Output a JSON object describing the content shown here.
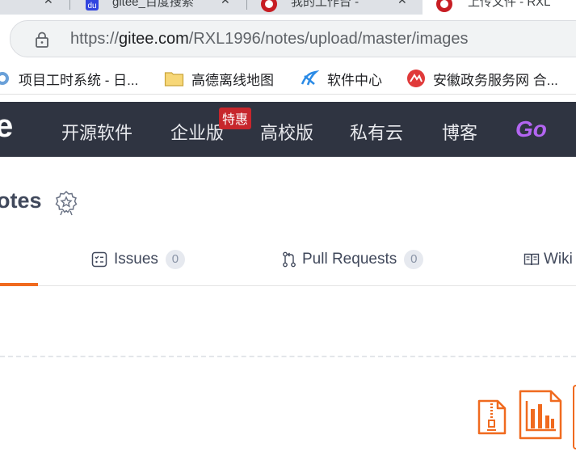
{
  "browser": {
    "tabs": [
      {
        "title": "gitee_百度搜索"
      },
      {
        "title": "我的工作台 -"
      },
      {
        "title": "上传文件 - RXL"
      }
    ],
    "url_prefix": "https://",
    "url_domain": "gitee.com",
    "url_path": "/RXL1996/notes/upload/master/images",
    "bookmarks": [
      {
        "label": "项目工时系统 - 日..."
      },
      {
        "label": "高德离线地图"
      },
      {
        "label": "软件中心"
      },
      {
        "label": "安徽政务服务网 合..."
      }
    ]
  },
  "site": {
    "logo_fragment": "e",
    "nav": [
      {
        "label": "开源软件"
      },
      {
        "label": "企业版"
      },
      {
        "label": "高校版"
      },
      {
        "label": "私有云"
      },
      {
        "label": "博客"
      }
    ],
    "hot_badge": "特惠",
    "go_label": "Go",
    "brand_color": "#f06a1f",
    "nav_bg": "#2f3441"
  },
  "repo": {
    "title_fragment": "otes",
    "tabs": [
      {
        "label": "Issues",
        "count": "0",
        "icon": "issues-icon"
      },
      {
        "label": "Pull Requests",
        "count": "0",
        "icon": "pull-request-icon"
      },
      {
        "label": "Wiki",
        "icon": "wiki-icon"
      }
    ]
  },
  "file_icons": [
    "zip-file-icon",
    "chart-file-icon"
  ]
}
